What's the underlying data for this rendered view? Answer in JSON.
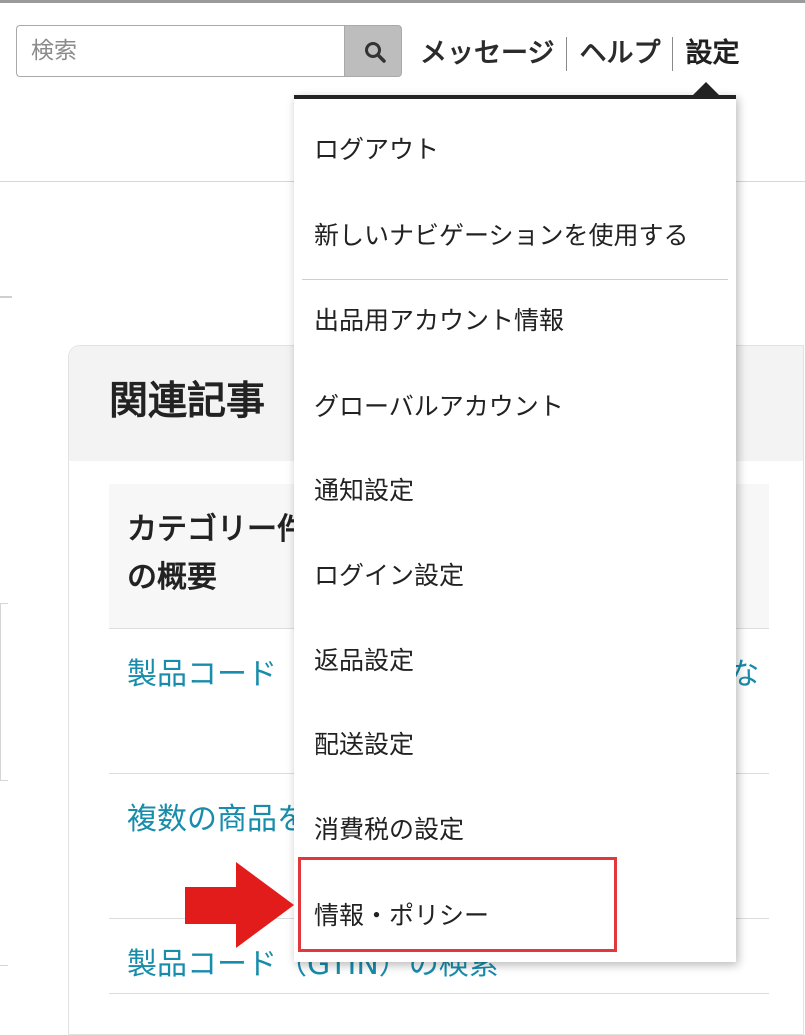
{
  "search": {
    "placeholder": "検索"
  },
  "top_nav": {
    "items": [
      {
        "label": "メッセージ"
      },
      {
        "label": "ヘルプ"
      },
      {
        "label": "設定"
      }
    ]
  },
  "related": {
    "title": "関連記事",
    "heading": "カテゴリー件の概要",
    "articles": [
      {
        "text": "製品コード（GTIN）がない場合の ISBN）がな"
      },
      {
        "text": "複数の商品をまとめて登録す るUPCガイド"
      },
      {
        "text": "製品コード（GTIN）の検索"
      }
    ]
  },
  "settings_menu": {
    "items": [
      {
        "label": "ログアウト"
      },
      {
        "label": "新しいナビゲーションを使用する"
      },
      {
        "label": "出品用アカウント情報"
      },
      {
        "label": "グローバルアカウント"
      },
      {
        "label": "通知設定"
      },
      {
        "label": "ログイン設定"
      },
      {
        "label": "返品設定"
      },
      {
        "label": "配送設定"
      },
      {
        "label": "消費税の設定"
      },
      {
        "label": "情報・ポリシー"
      }
    ]
  },
  "annotation": {
    "highlight_color": "#e2373d",
    "arrow_color": "#e21b1b"
  }
}
